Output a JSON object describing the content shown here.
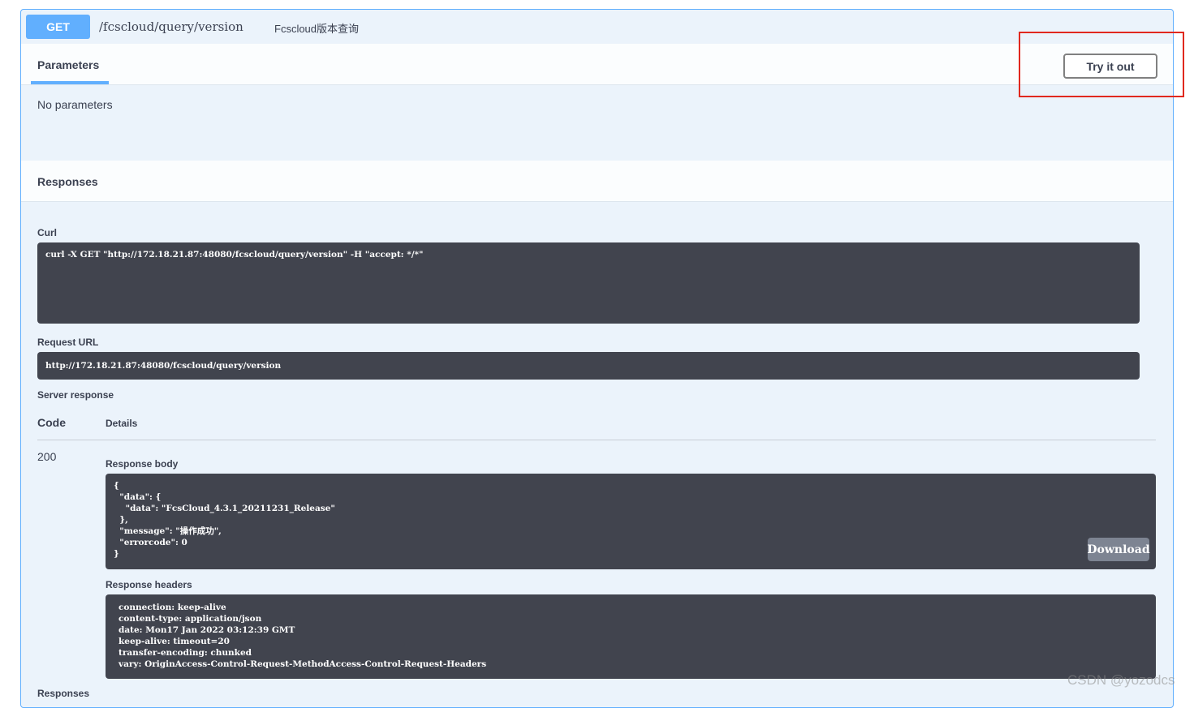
{
  "endpoint": {
    "method": "GET",
    "path": "/fcscloud/query/version",
    "description": "Fcscloud版本查询"
  },
  "parameters": {
    "tab_label": "Parameters",
    "try_button": "Try it out",
    "empty_text": "No parameters"
  },
  "responses": {
    "header_label": "Responses",
    "curl_label": "Curl",
    "curl_command": "curl -X GET \"http://172.18.21.87:48080/fcscloud/query/version\" -H \"accept: */*\"",
    "request_url_label": "Request URL",
    "request_url": "http://172.18.21.87:48080/fcscloud/query/version",
    "server_response_label": "Server response",
    "code_col": "Code",
    "details_col": "Details",
    "status_code": "200",
    "body_label": "Response body",
    "body_text": "{\n  \"data\": {\n    \"data\": \"FcsCloud_4.3.1_20211231_Release\"\n  },\n  \"message\": \"操作成功\",\n  \"errorcode\": 0\n}",
    "download_label": "Download",
    "headers_label": "Response headers",
    "headers_text": "connection: keep-alive\ncontent-type: application/json\ndate: Mon17 Jan 2022 03:12:39 GMT\nkeep-alive: timeout=20\ntransfer-encoding: chunked\nvary: OriginAccess-Control-Request-MethodAccess-Control-Request-Headers",
    "footer_label": "Responses"
  },
  "watermark": "CSDN @yozodcs",
  "colors": {
    "get_method": "#61affe",
    "code_background": "#41444e",
    "annotation_box": "#e0281e"
  }
}
